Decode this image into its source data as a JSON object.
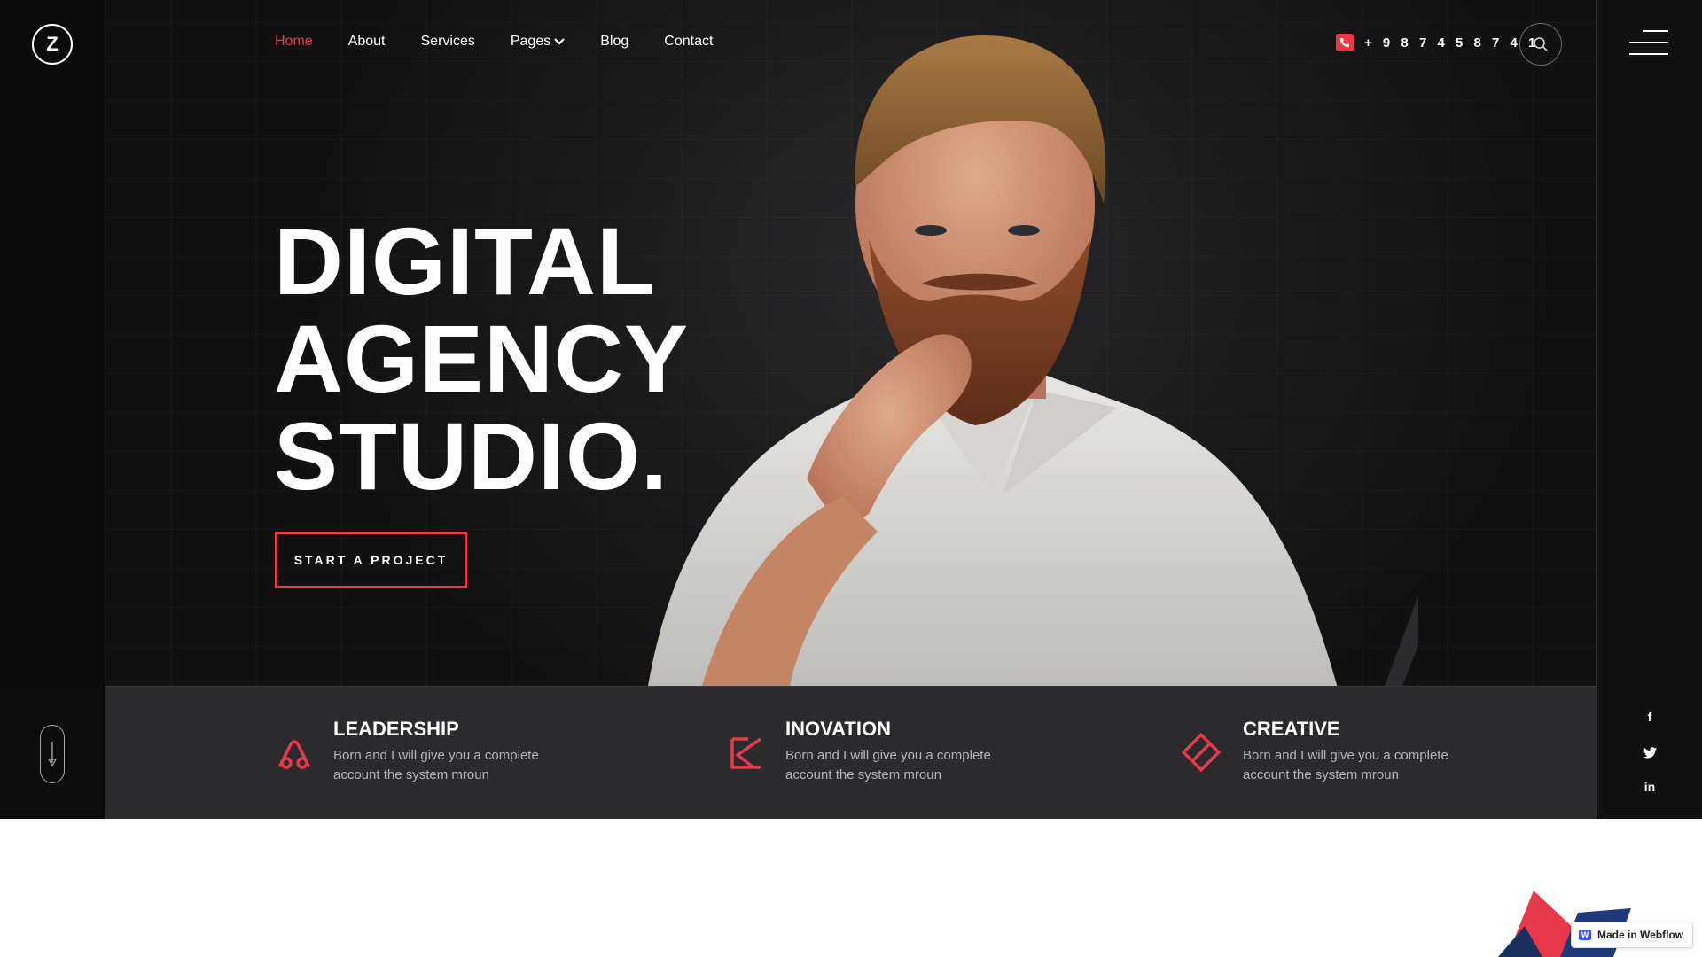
{
  "header": {
    "logo_letter": "Z",
    "nav": [
      {
        "label": "Home",
        "active": true
      },
      {
        "label": "About",
        "active": false
      },
      {
        "label": "Services",
        "active": false
      },
      {
        "label": "Pages",
        "active": false,
        "has_dropdown": true
      },
      {
        "label": "Blog",
        "active": false
      },
      {
        "label": "Contact",
        "active": false
      }
    ],
    "phone": "+ 9 8 7 4 5 8 7 4 1"
  },
  "hero": {
    "headline": [
      "DIGITAL",
      "AGENCY",
      "STUDIO."
    ],
    "cta_label": "START A PROJECT"
  },
  "features": [
    {
      "title": "LEADERSHIP",
      "text": "Born and I will give you a complete account the system mroun",
      "icon": "leadership-icon"
    },
    {
      "title": "INOVATION",
      "text": "Born and I will give you a complete account the system mroun",
      "icon": "innovation-icon"
    },
    {
      "title": "CREATIVE",
      "text": "Born and I will give you a complete account the system mroun",
      "icon": "creative-icon"
    }
  ],
  "social": [
    "f",
    "t",
    "in"
  ],
  "badge": {
    "label": "Made in Webflow"
  },
  "colors": {
    "accent": "#e8394b",
    "dark": "#1a1a1b",
    "strip": "#222225"
  }
}
